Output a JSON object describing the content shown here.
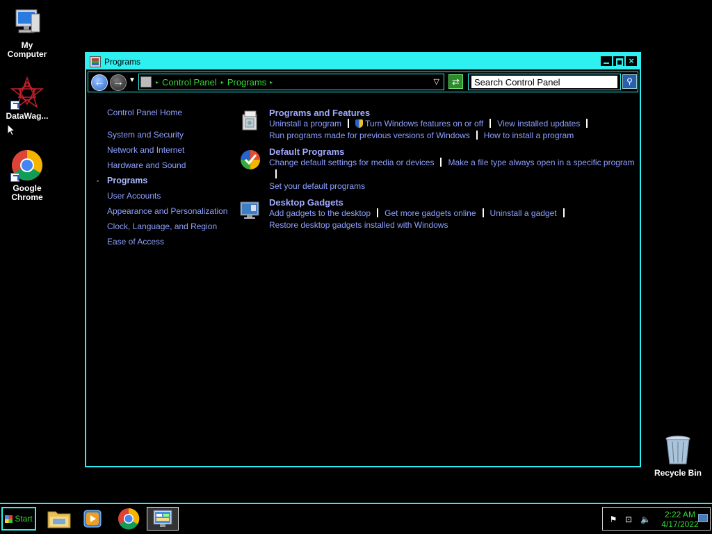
{
  "desktop": {
    "icons": [
      {
        "label": "My Computer",
        "icon": "computer-icon"
      },
      {
        "label": "DataWag...",
        "icon": "datawag-app-icon"
      },
      {
        "label": "Google Chrome",
        "icon": "chrome-icon"
      },
      {
        "label": "Recycle Bin",
        "icon": "recycle-bin-icon"
      }
    ]
  },
  "window": {
    "title": "Programs",
    "controls": {
      "minimize": "minimize-icon",
      "maximize": "maximize-icon",
      "close": "×"
    },
    "address": {
      "crumbs": [
        "Control Panel",
        "Programs"
      ]
    },
    "search": {
      "value": "Search Control Panel"
    }
  },
  "leftnav": {
    "home": "Control Panel Home",
    "items": [
      {
        "label": "System and Security",
        "current": false
      },
      {
        "label": "Network and Internet",
        "current": false
      },
      {
        "label": "Hardware and Sound",
        "current": false
      },
      {
        "label": "Programs",
        "current": true
      },
      {
        "label": "User Accounts",
        "current": false
      },
      {
        "label": "Appearance and Personalization",
        "current": false
      },
      {
        "label": "Clock, Language, and Region",
        "current": false
      },
      {
        "label": "Ease of Access",
        "current": false
      }
    ]
  },
  "sections": [
    {
      "title": "Programs and Features",
      "icon": "programs-features-icon",
      "lines": [
        [
          "Uninstall a program",
          "Turn Windows features on or off",
          "View installed updates"
        ],
        [
          "Run programs made for previous versions of Windows",
          "How to install a program"
        ]
      ]
    },
    {
      "title": "Default Programs",
      "icon": "default-programs-icon",
      "lines": [
        [
          "Change default settings for media or devices",
          "Make a file type always open in a specific program"
        ],
        [
          "Set your default programs"
        ]
      ]
    },
    {
      "title": "Desktop Gadgets",
      "icon": "desktop-gadgets-icon",
      "lines": [
        [
          "Add gadgets to the desktop",
          "Get more gadgets online",
          "Uninstall a gadget"
        ],
        [
          "Restore desktop gadgets installed with Windows"
        ]
      ]
    }
  ],
  "taskbar": {
    "start_label": "Start",
    "clock_time": "2:22 AM",
    "clock_date": "4/17/2022"
  },
  "colors": {
    "accent": "#2ff0f0",
    "link": "#8ea0ff",
    "crumb_green": "#35d835"
  }
}
